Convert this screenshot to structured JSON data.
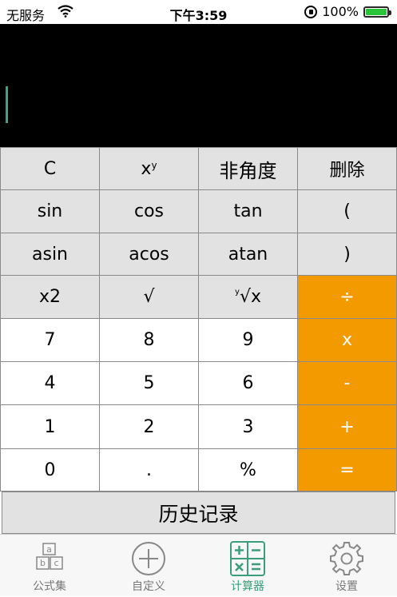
{
  "status": {
    "carrier": "无服务",
    "time": "下午3:59",
    "battery": "100%",
    "battery_level": 1.0
  },
  "display": {
    "value": ""
  },
  "keys": {
    "c": "C",
    "pow_base": "x",
    "pow_exp": "y",
    "mode": "非角度",
    "delete": "删除",
    "sin": "sin",
    "cos": "cos",
    "tan": "tan",
    "lparen": "(",
    "asin": "asin",
    "acos": "acos",
    "atan": "atan",
    "rparen": ")",
    "square": "x2",
    "sqrt": "√",
    "root_idx": "y",
    "root_body": "√x",
    "divide": "÷",
    "seven": "7",
    "eight": "8",
    "nine": "9",
    "multiply": "x",
    "four": "4",
    "five": "5",
    "six": "6",
    "minus": "-",
    "one": "1",
    "two": "2",
    "three": "3",
    "plus": "+",
    "zero": "0",
    "dot": ".",
    "percent": "%",
    "equals": "="
  },
  "history": {
    "label": "历史记录"
  },
  "tabs": [
    {
      "label": "公式集"
    },
    {
      "label": "自定义"
    },
    {
      "label": "计算器"
    },
    {
      "label": "设置"
    }
  ],
  "colors": {
    "accent": "#3a9e7a",
    "operator": "#f29a00",
    "display_bg": "#000000"
  }
}
